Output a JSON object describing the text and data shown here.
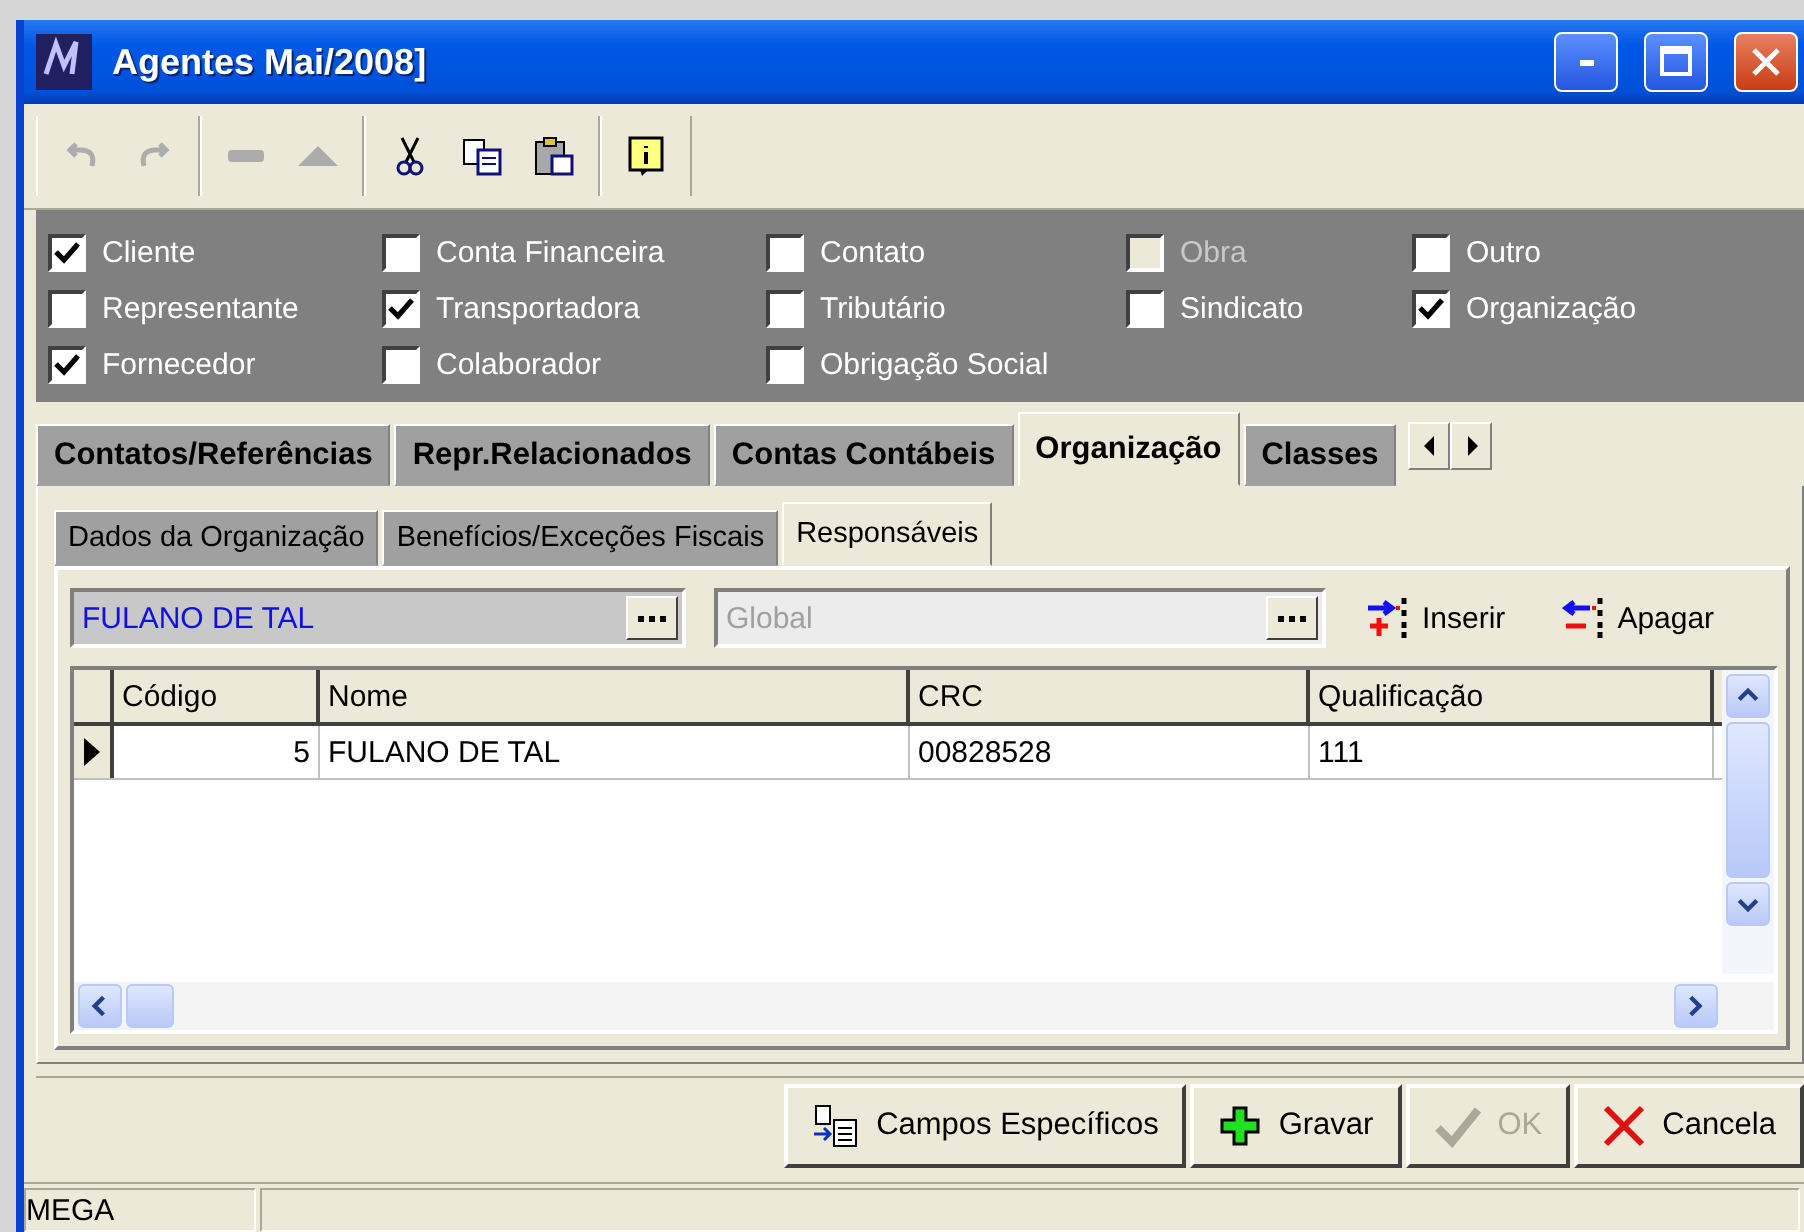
{
  "window": {
    "title": "Agentes Mai/2008]"
  },
  "toolbar": {
    "groups": [
      [
        {
          "kind": "undo",
          "disabled": true
        },
        {
          "kind": "redo",
          "disabled": true
        }
      ],
      [
        {
          "kind": "minus",
          "disabled": true
        },
        {
          "kind": "up",
          "disabled": true
        }
      ],
      [
        {
          "kind": "cut",
          "disabled": false
        },
        {
          "kind": "copy",
          "disabled": false
        },
        {
          "kind": "paste",
          "disabled": false
        }
      ],
      [
        {
          "kind": "info",
          "disabled": false
        }
      ]
    ]
  },
  "agent_types": {
    "columns": [
      [
        {
          "label": "Cliente",
          "checked": true,
          "disabled": false
        },
        {
          "label": "Representante",
          "checked": false,
          "disabled": false
        },
        {
          "label": "Fornecedor",
          "checked": true,
          "disabled": false
        }
      ],
      [
        {
          "label": "Conta Financeira",
          "checked": false,
          "disabled": false
        },
        {
          "label": "Transportadora",
          "checked": true,
          "disabled": false
        },
        {
          "label": "Colaborador",
          "checked": false,
          "disabled": false
        }
      ],
      [
        {
          "label": "Contato",
          "checked": false,
          "disabled": false
        },
        {
          "label": "Tributário",
          "checked": false,
          "disabled": false
        },
        {
          "label": "Obrigação Social",
          "checked": false,
          "disabled": false
        }
      ],
      [
        {
          "label": "Obra",
          "checked": false,
          "disabled": true
        },
        {
          "label": "Sindicato",
          "checked": false,
          "disabled": false
        }
      ],
      [
        {
          "label": "Outro",
          "checked": false,
          "disabled": false
        },
        {
          "label": "Organização",
          "checked": true,
          "disabled": false
        }
      ]
    ]
  },
  "tabs": [
    {
      "label": "Contatos/Referências",
      "selected": false
    },
    {
      "label": "Repr.Relacionados",
      "selected": false
    },
    {
      "label": "Contas Contábeis",
      "selected": false
    },
    {
      "label": "Organização",
      "selected": true
    },
    {
      "label": "Classes",
      "selected": false
    }
  ],
  "subtabs": [
    {
      "label": "Dados da Organização",
      "selected": false
    },
    {
      "label": "Benefícios/Exceções Fiscais",
      "selected": false
    },
    {
      "label": "Responsáveis",
      "selected": true
    }
  ],
  "lookup": {
    "person": {
      "value": "FULANO DE TAL",
      "disabled": false
    },
    "scope": {
      "value": "Global",
      "disabled": true
    }
  },
  "actions": [
    {
      "kind": "insert",
      "label": "Inserir"
    },
    {
      "kind": "delete",
      "label": "Apagar"
    }
  ],
  "table": {
    "columns": [
      "Código",
      "Nome",
      "CRC",
      "Qualificação"
    ],
    "rows": [
      {
        "cells": [
          "5",
          "FULANO DE TAL",
          "00828528",
          "111"
        ],
        "selected": true
      }
    ]
  },
  "buttons": [
    {
      "kind": "fields",
      "label": "Campos Específicos",
      "disabled": false
    },
    {
      "kind": "save",
      "label": "Gravar",
      "disabled": false
    },
    {
      "kind": "ok",
      "label": "OK",
      "disabled": true
    },
    {
      "kind": "cancel",
      "label": "Cancela",
      "disabled": false
    }
  ],
  "status_bar": [
    "MEGA"
  ]
}
